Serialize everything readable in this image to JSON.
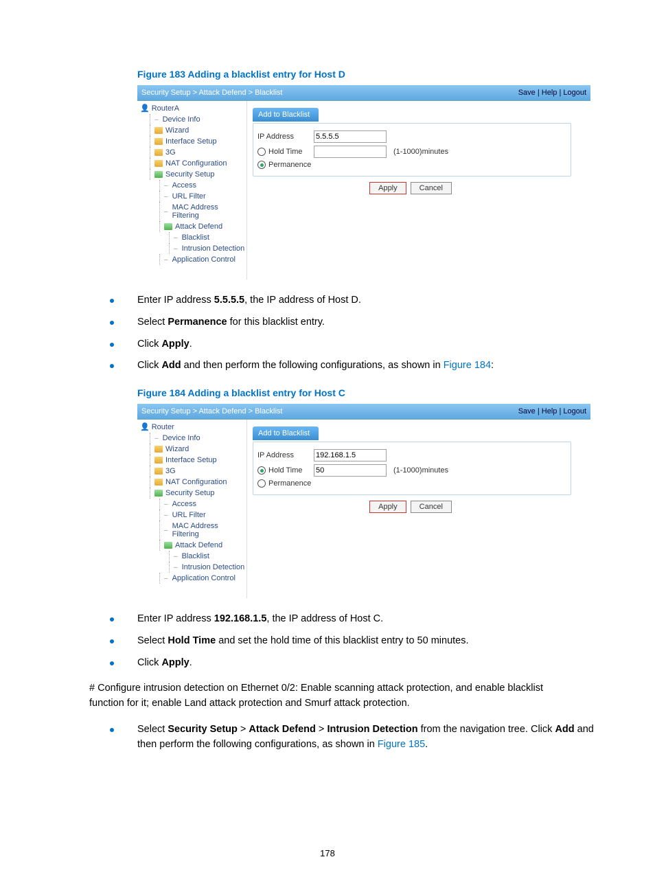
{
  "figure183_title": "Figure 183 Adding a blacklist entry for Host D",
  "figure184_title": "Figure 184 Adding a blacklist entry for Host C",
  "screenshot_common": {
    "breadcrumb": "Security Setup > Attack Defend > Blacklist",
    "top_links": "Save | Help | Logout",
    "nav": {
      "device_info": "Device Info",
      "wizard": "Wizard",
      "interface_setup": "Interface Setup",
      "threeg": "3G",
      "nat_config": "NAT Configuration",
      "security_setup": "Security Setup",
      "access": "Access",
      "url_filter": "URL Filter",
      "mac_filter": "MAC Address Filtering",
      "attack_defend": "Attack Defend",
      "blacklist": "Blacklist",
      "intrusion": "Intrusion Detection",
      "app_control": "Application Control"
    },
    "tab_label": "Add to Blacklist",
    "ip_label": "IP Address",
    "holdtime_label": "Hold Time",
    "permanence_label": "Permanence",
    "holdtime_hint": "(1-1000)minutes",
    "apply_btn": "Apply",
    "cancel_btn": "Cancel"
  },
  "fig183": {
    "router_label": "RouterA",
    "ip_value": "5.5.5.5",
    "holdtime_value": "",
    "holdtime_selected": false,
    "permanence_selected": true
  },
  "fig184": {
    "router_label": "Router",
    "ip_value": "192.168.1.5",
    "holdtime_value": "50",
    "holdtime_selected": true,
    "permanence_selected": false
  },
  "instructions1": {
    "i1_a": "Enter IP address ",
    "i1_b": "5.5.5.5",
    "i1_c": ", the IP address of Host D.",
    "i2_a": "Select ",
    "i2_b": "Permanence",
    "i2_c": " for this blacklist entry.",
    "i3_a": "Click ",
    "i3_b": "Apply",
    "i3_c": ".",
    "i4_a": "Click ",
    "i4_b": "Add",
    "i4_c": " and then perform the following configurations, as shown in ",
    "i4_link": "Figure 184",
    "i4_d": ":"
  },
  "instructions2": {
    "i1_a": "Enter IP address ",
    "i1_b": "192.168.1.5",
    "i1_c": ", the IP address of Host C.",
    "i2_a": "Select ",
    "i2_b": "Hold Time",
    "i2_c": " and set the hold time of this blacklist entry to 50 minutes.",
    "i3_a": "Click ",
    "i3_b": "Apply",
    "i3_c": "."
  },
  "body_para": "# Configure intrusion detection on Ethernet 0/2: Enable scanning attack protection, and enable blacklist function for it; enable Land attack protection and Smurf attack protection.",
  "instructions3": {
    "i1_a": "Select ",
    "i1_b": "Security Setup",
    "i1_c": " > ",
    "i1_d": "Attack Defend",
    "i1_e": " > ",
    "i1_f": "Intrusion Detection",
    "i1_g": " from the navigation tree. Click ",
    "i1_h": "Add",
    "i1_i": " and then perform the following configurations, as shown in ",
    "i1_link": "Figure 185",
    "i1_j": "."
  },
  "page_number": "178"
}
